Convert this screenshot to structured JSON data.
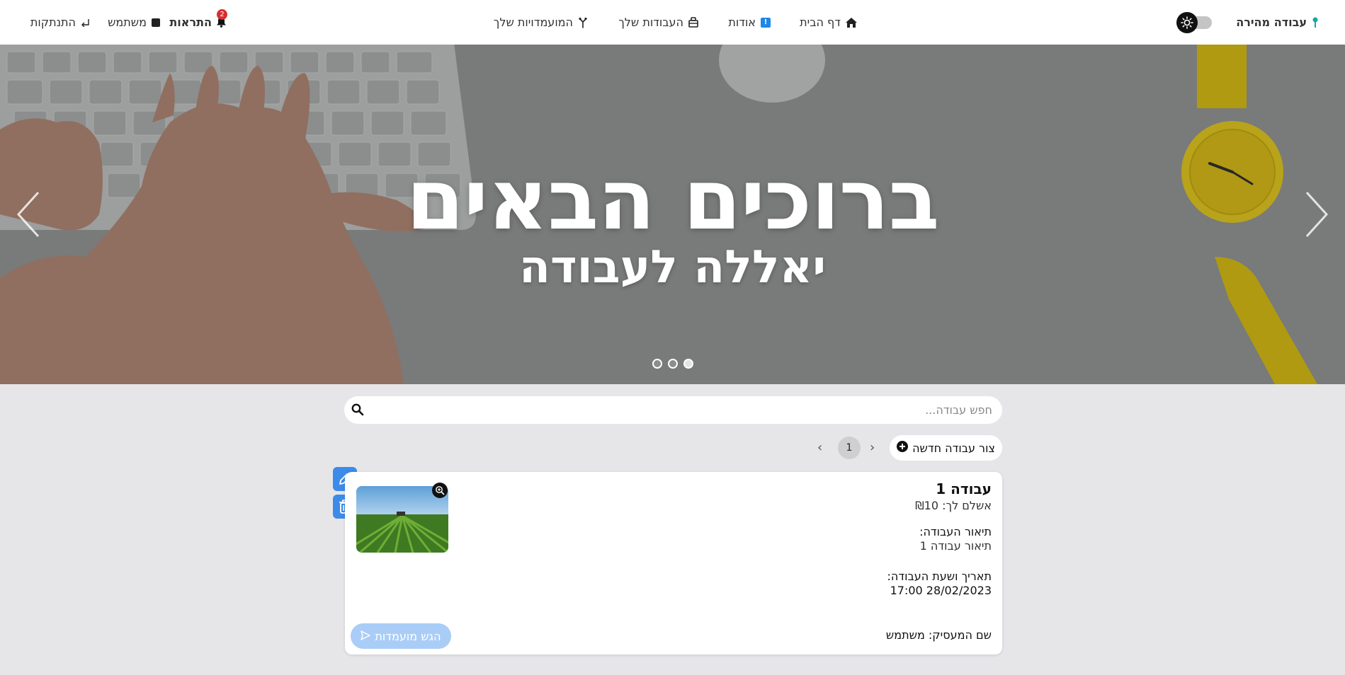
{
  "navbar": {
    "brand": "עבודה מהירה",
    "home": "דף הבית",
    "about": "אודות",
    "jobs": "העבודות שלך",
    "candidates": "המועמדויות שלך",
    "notifications": "התראות",
    "notifications_count": "2",
    "user": "משתמש",
    "logout": "התנתקות"
  },
  "hero": {
    "title": "ברוכים הבאים",
    "subtitle": "יאללה לעבודה",
    "slides_count": 3,
    "active_slide": 3
  },
  "search": {
    "placeholder": "חפש עבודה..."
  },
  "toolbar": {
    "new_job": "צור עבודה חדשה",
    "current_page": "1"
  },
  "job": {
    "title": "עבודה 1",
    "pay": "אשלם לך: ₪10",
    "description_label": "תיאור העבודה:",
    "description": "תיאור עבודה 1",
    "date_label": "תאריך ושעת העבודה:",
    "date": "28/02/2023 17:00",
    "employer": "שם המעסיק: משתמש",
    "submit_label": "הגש מועמדות"
  },
  "colors": {
    "accent": "#3d8be8",
    "badge": "#d62f2f",
    "disabled_button": "#a9cdf7",
    "page_background": "#e6e6e9"
  },
  "icons": {
    "brand": "pin-icon",
    "home": "home-icon",
    "about": "info-icon",
    "jobs": "briefcase-icon",
    "candidates": "candidate-icon",
    "notifications": "bell-icon",
    "user": "user-icon",
    "logout": "logout-icon",
    "search": "search-icon",
    "new_job": "plus-circle-icon",
    "edit": "pencil-icon",
    "delete": "trash-icon",
    "zoom": "zoom-icon",
    "submit": "send-icon",
    "theme": "sun-icon"
  }
}
